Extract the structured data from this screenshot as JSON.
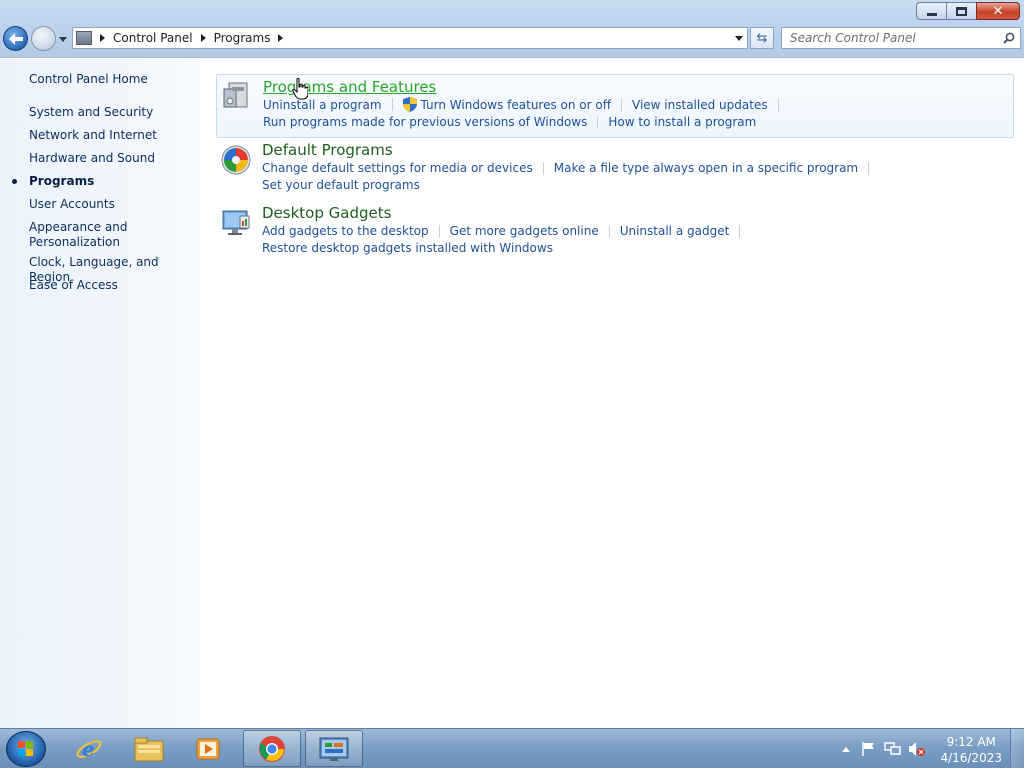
{
  "window": {
    "breadcrumb": [
      "Control Panel",
      "Programs"
    ],
    "search_placeholder": "Search Control Panel"
  },
  "sidebar": {
    "items": [
      {
        "label": "Control Panel Home"
      },
      {
        "label": "System and Security"
      },
      {
        "label": "Network and Internet"
      },
      {
        "label": "Hardware and Sound"
      },
      {
        "label": "Programs",
        "current": true
      },
      {
        "label": "User Accounts"
      },
      {
        "label": "Appearance and\nPersonalization"
      },
      {
        "label": "Clock, Language, and Region"
      },
      {
        "label": "Ease of Access"
      }
    ]
  },
  "categories": [
    {
      "title": "Programs and Features",
      "icon": "programs-features-icon",
      "links_row1": [
        "Uninstall a program",
        "Turn Windows features on or off",
        "View installed updates"
      ],
      "links_row2": [
        "Run programs made for previous versions of Windows",
        "How to install a program"
      ]
    },
    {
      "title": "Default Programs",
      "icon": "default-programs-icon",
      "links_row1": [
        "Change default settings for media or devices",
        "Make a file type always open in a specific program"
      ],
      "links_row2": [
        "Set your default programs"
      ]
    },
    {
      "title": "Desktop Gadgets",
      "icon": "desktop-gadgets-icon",
      "links_row1": [
        "Add gadgets to the desktop",
        "Get more gadgets online",
        "Uninstall a gadget"
      ],
      "links_row2": [
        "Restore desktop gadgets installed with Windows"
      ]
    }
  ],
  "taskbar": {
    "items": [
      "internet-explorer-icon",
      "windows-explorer-icon",
      "media-player-icon",
      "chrome-icon",
      "control-panel-icon"
    ],
    "time": "9:12 AM",
    "date": "4/16/2023"
  },
  "colors": {
    "link": "#1e5298",
    "category_title": "#1e5d1e",
    "category_hover": "#2ba62b"
  }
}
